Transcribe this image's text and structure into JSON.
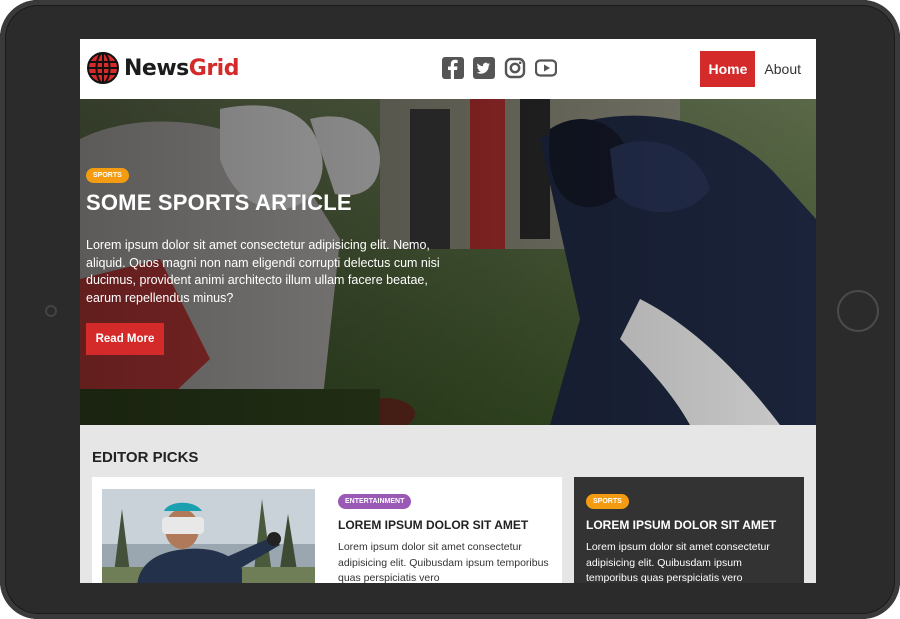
{
  "brand": {
    "name_part1": "News",
    "name_part2": "Grid"
  },
  "social": {
    "icons": [
      "facebook-square-icon",
      "twitter-square-icon",
      "instagram-icon",
      "youtube-icon"
    ]
  },
  "nav": {
    "home_label": "Home",
    "about_label": "About"
  },
  "hero": {
    "badge": "SPORTS",
    "title": "SOME SPORTS ARTICLE",
    "text": "Lorem ipsum dolor sit amet consectetur adipisicing elit. Nemo, aliquid. Quos magni non nam eligendi corrupti delectus cum nisi ducimus, provident animi architecto illum ullam facere beatae, earum repellendus minus?",
    "button_label": "Read More"
  },
  "editor_picks": {
    "heading": "EDITOR PICKS",
    "cards": [
      {
        "badge": "ENTERTAINMENT",
        "title": "LOREM IPSUM DOLOR SIT AMET",
        "text": "Lorem ipsum dolor sit amet consectetur adipisicing elit. Quibusdam ipsum temporibus quas perspiciatis vero"
      },
      {
        "badge": "SPORTS",
        "title": "LOREM IPSUM DOLOR SIT AMET",
        "text": "Lorem ipsum dolor sit amet consectetur adipisicing elit. Quibusdam ipsum temporibus quas perspiciatis vero"
      }
    ]
  },
  "colors": {
    "accent": "#d42a2a",
    "sports_badge": "#f39c12",
    "entertainment_badge": "#9b59b6",
    "dark_card": "#333333"
  }
}
